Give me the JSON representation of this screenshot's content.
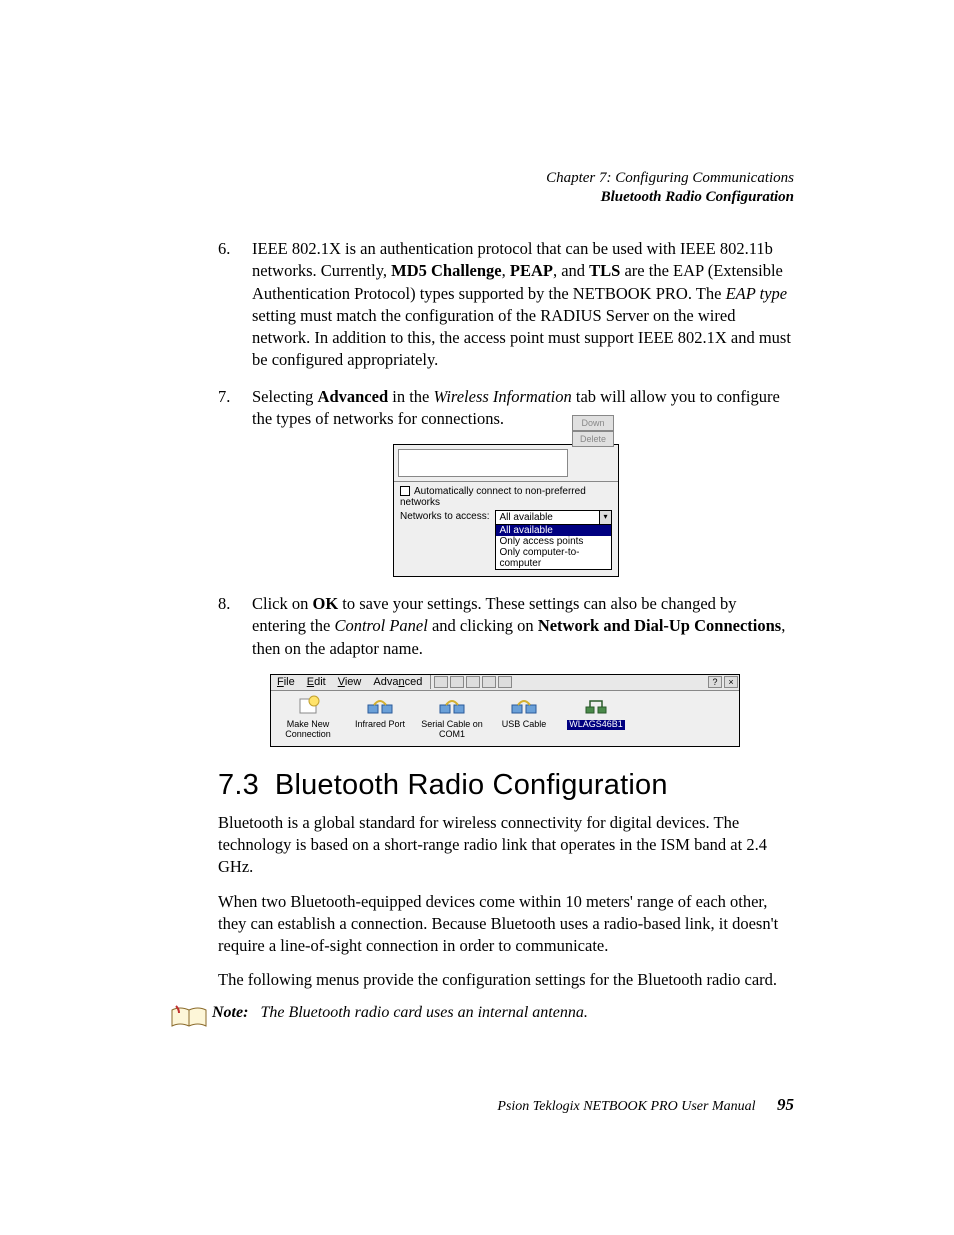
{
  "header": {
    "chapter": "Chapter 7:  Configuring Communications",
    "section": "Bluetooth Radio Configuration"
  },
  "steps": [
    {
      "n": "6.",
      "parts": [
        {
          "t": "IEEE 802.1X is an authentication protocol that can be used with IEEE 802.11b networks. Currently, "
        },
        {
          "t": "MD5 Challenge",
          "b": true
        },
        {
          "t": ", "
        },
        {
          "t": "PEAP",
          "b": true
        },
        {
          "t": ", and "
        },
        {
          "t": "TLS",
          "b": true
        },
        {
          "t": " are the EAP (Extensible Authentication Protocol) types supported by the NETBOOK PRO. The "
        },
        {
          "t": "EAP type",
          "i": true
        },
        {
          "t": " setting must match the configuration of the RADIUS Server on the wired network. In addition to this, the access point must support IEEE 802.1X and must be configured appropriately."
        }
      ]
    },
    {
      "n": "7.",
      "parts": [
        {
          "t": "Selecting "
        },
        {
          "t": "Advanced",
          "b": true
        },
        {
          "t": " in the "
        },
        {
          "t": "Wireless Information",
          "i": true
        },
        {
          "t": " tab will allow you to configure the types of networks for connections."
        }
      ]
    },
    {
      "n": "8.",
      "parts": [
        {
          "t": "Click on "
        },
        {
          "t": "OK",
          "b": true
        },
        {
          "t": " to save your settings. These settings can also be changed by entering the "
        },
        {
          "t": "Control Panel",
          "i": true
        },
        {
          "t": " and clicking on "
        },
        {
          "t": "Network and Dial-Up Connections",
          "b": true
        },
        {
          "t": ", then on the adaptor name."
        }
      ]
    }
  ],
  "shot1": {
    "down": "Down",
    "delete": "Delete",
    "checkbox_label": "Automatically connect to non-preferred networks",
    "access_label": "Networks to access:",
    "selected": "All available",
    "options": [
      "All available",
      "Only access points",
      "Only computer-to-computer"
    ]
  },
  "shot2": {
    "menus": [
      {
        "pre": "",
        "u": "F",
        "post": "ile"
      },
      {
        "pre": "",
        "u": "E",
        "post": "dit"
      },
      {
        "pre": "",
        "u": "V",
        "post": "iew"
      },
      {
        "pre": "Adva",
        "u": "n",
        "post": "ced"
      }
    ],
    "help": "?",
    "close": "×",
    "icons": [
      {
        "label": "Make New Connection",
        "kind": "new"
      },
      {
        "label": "Infrared Port",
        "kind": "conn"
      },
      {
        "label": "Serial Cable on COM1",
        "kind": "conn"
      },
      {
        "label": "USB Cable",
        "kind": "conn"
      },
      {
        "label": "WLAGS46B1",
        "kind": "net",
        "selected": true
      }
    ]
  },
  "section": {
    "num": "7.3",
    "title": "Bluetooth Radio Configuration"
  },
  "paras": [
    "Bluetooth is a global standard for wireless connectivity for digital devices. The technology is based on a short-range radio link that operates in the ISM band at 2.4 GHz.",
    "When two Bluetooth-equipped devices come within 10 meters' range of each other, they can establish a connection. Because Bluetooth uses a radio-based link, it doesn't require a line-of-sight connection in order to communicate.",
    "The following menus provide the configuration settings for the Bluetooth radio card."
  ],
  "note": {
    "lead": "Note:",
    "text": "The Bluetooth radio card uses an internal antenna."
  },
  "footer": {
    "text": "Psion Teklogix NETBOOK PRO User Manual",
    "page": "95"
  }
}
